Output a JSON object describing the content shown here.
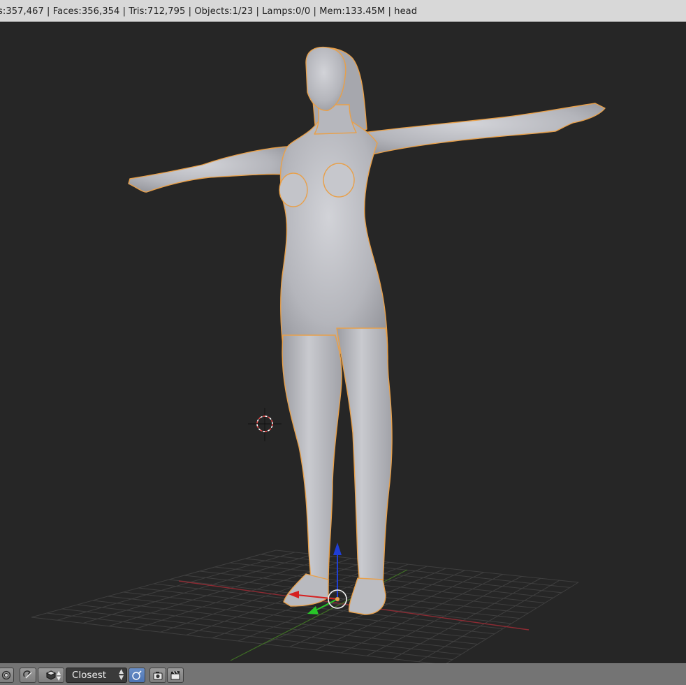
{
  "info_bar": {
    "stats": "s:357,467 | Faces:356,354 | Tris:712,795 | Objects:1/23 | Lamps:0/0 | Mem:133.45M | head"
  },
  "header": {
    "snap_target": "Closest",
    "icons": [
      "pivot-point-icon",
      "proportional-editing-icon",
      "snap-element-icon",
      "snap-target-dropdown",
      "snap-rotation-icon",
      "render-image-icon",
      "render-animation-icon"
    ]
  },
  "colors": {
    "viewport_bg": "#262626",
    "grid": "#3c3c3c",
    "x_axis": "#9a2e35",
    "y_axis": "#4c7d2a",
    "mesh": "#b8b9be",
    "outline": "#f0a040",
    "info_bar": "#d8d8d8",
    "header_bar": "#747474"
  }
}
